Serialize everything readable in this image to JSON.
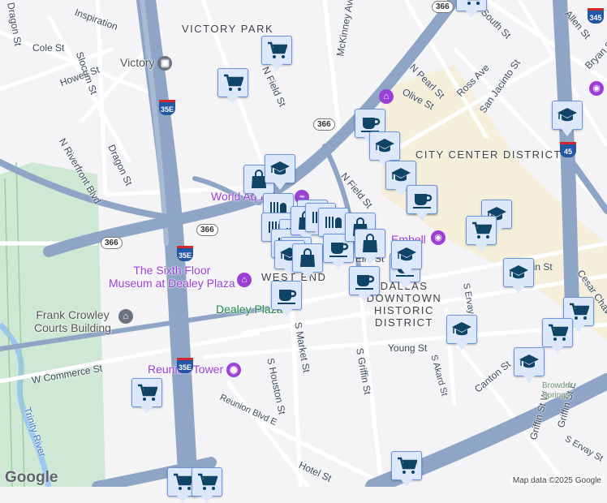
{
  "map": {
    "attribution": "Map data ©2025 Google",
    "logo": "Google",
    "districts": [
      "VICTORY PARK",
      "CITY CENTER DISTRICT",
      "WEST END",
      "DALLAS DOWNTOWN HISTORIC DISTRICT"
    ],
    "streets": [
      "Inspiration",
      "Cole St",
      "Howell St",
      "Slocum St",
      "N Riverfront Blvd",
      "Dragon St",
      "N Field St",
      "N Field St",
      "McKinney Ave",
      "N Pearl St",
      "Ross Ave",
      "San Jacinto St",
      "Olive St",
      "Allen St",
      "Bryan St",
      "Young St",
      "S Griffin St",
      "S Market St",
      "S Houston St",
      "Reunion Blvd E",
      "W Commerce St",
      "Canton St",
      "S Akard St",
      "S Ervay St",
      "Cesar Chavez",
      "Griffin St W",
      "Griffin St E",
      "Hotel St",
      "South St",
      "Elm St",
      "Main St",
      "Dragon St",
      "S Ervay St"
    ],
    "places": {
      "victory": "Victory",
      "aquarium": "World Aquarium",
      "sixth_floor": "The Sixth Floor\nMuseum at Dealey Plaza",
      "dealey": "Dealey Plaza",
      "courts": "Frank Crowley\nCourts Building",
      "reunion": "Reunion Tower",
      "trinity": "Trinity River",
      "browder": "Browder\nSprings",
      "elmstreet": "Embell"
    },
    "shields": {
      "i35e": "35E",
      "sr366": "366",
      "i345": "345",
      "i45": "45"
    },
    "marker_types": [
      "cart",
      "cart",
      "cart",
      "mug",
      "grad",
      "grad",
      "mug",
      "bag",
      "grad",
      "grad",
      "grad",
      "cart",
      "grad",
      "cart",
      "cart",
      "grad",
      "grad",
      "cart",
      "cart",
      "cart",
      "cart",
      "store",
      "store",
      "store",
      "store",
      "store",
      "bag",
      "store",
      "store",
      "store",
      "grad",
      "bag",
      "mug",
      "bag",
      "bag",
      "mug",
      "grad",
      "mug",
      "mug",
      "mug"
    ],
    "colors": {
      "highway": "#8ea5c6",
      "marker_fill": "#dde8fb",
      "marker_border": "#6b95dc",
      "icon": "#0f4466",
      "park": "#cfe8d4",
      "river": "#9cc7ef",
      "downtown": "#f5ebcf"
    }
  }
}
